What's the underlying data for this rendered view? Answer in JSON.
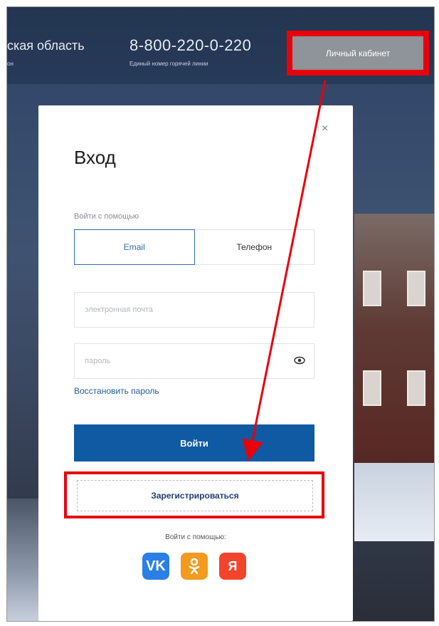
{
  "header": {
    "region": "ская область",
    "region_sub": "он",
    "phone": "8-800-220-0-220",
    "phone_sub": "Единый номер горячей линии",
    "cabinet_label": "Личный кабинет"
  },
  "modal": {
    "close": "×",
    "title": "Вход",
    "login_with": "Войти с помощью",
    "tabs": [
      {
        "label": "Email",
        "active": true
      },
      {
        "label": "Телефон",
        "active": false
      }
    ],
    "email_placeholder": "электронная почта",
    "password_placeholder": "пароль",
    "restore_label": "Восстановить пароль",
    "login_button": "Войти",
    "register_button": "Зарегистрироваться",
    "social_label": "Войти с помощью:",
    "socials": [
      {
        "name": "vk",
        "glyph": "VK",
        "color": "#2a7fe6"
      },
      {
        "name": "ok",
        "glyph": "ОК",
        "color": "#f39a1f"
      },
      {
        "name": "yandex",
        "glyph": "Я",
        "color": "#f2452b"
      }
    ]
  },
  "colors": {
    "primary": "#0f5aa3",
    "highlight": "#e8000b"
  }
}
